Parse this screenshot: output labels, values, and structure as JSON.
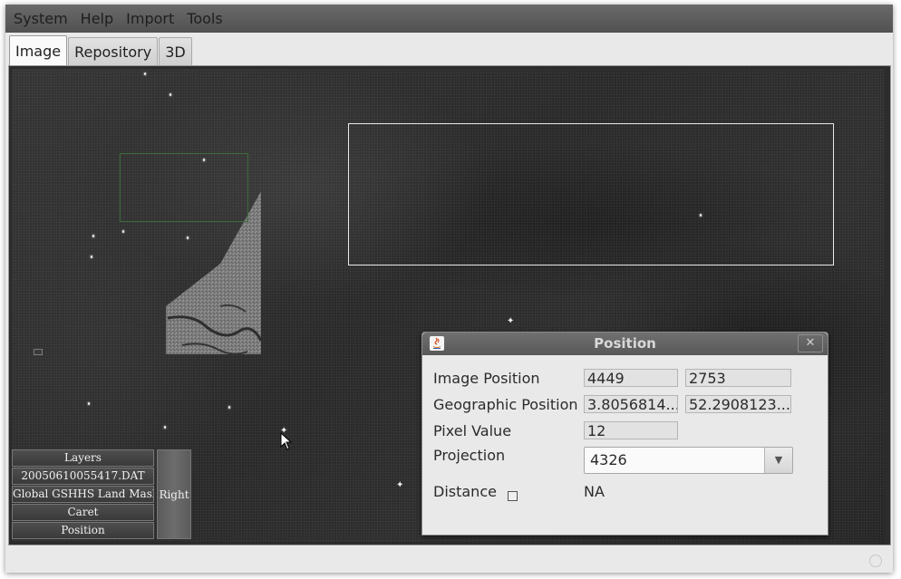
{
  "menubar": {
    "items": [
      "System",
      "Help",
      "Import",
      "Tools"
    ]
  },
  "tabs": [
    {
      "label": "Image",
      "active": true
    },
    {
      "label": "Repository",
      "active": false
    },
    {
      "label": "3D",
      "active": false
    }
  ],
  "layers": {
    "buttons": [
      "Layers",
      "20050610055417.DAT",
      "Global GSHHS Land Mask",
      "Caret",
      "Position"
    ],
    "right_button": "Right"
  },
  "position_dialog": {
    "title": "Position",
    "close_symbol": "✕",
    "image_position": {
      "label": "Image Position",
      "x": "4449",
      "y": "2753"
    },
    "geographic_position": {
      "label": "Geographic Position",
      "lon": "3.8056814...",
      "lat": "52.2908123..."
    },
    "pixel_value": {
      "label": "Pixel Value",
      "value": "12"
    },
    "projection": {
      "label": "Projection",
      "value": "4326"
    },
    "distance": {
      "label": "Distance",
      "checked": false,
      "value": "NA"
    }
  },
  "colors": {
    "menubar": "#5e5e5e",
    "image_background": "#2c2c2c",
    "roi_green": "#3c6b3c",
    "roi_white": "#e8e8e8"
  }
}
